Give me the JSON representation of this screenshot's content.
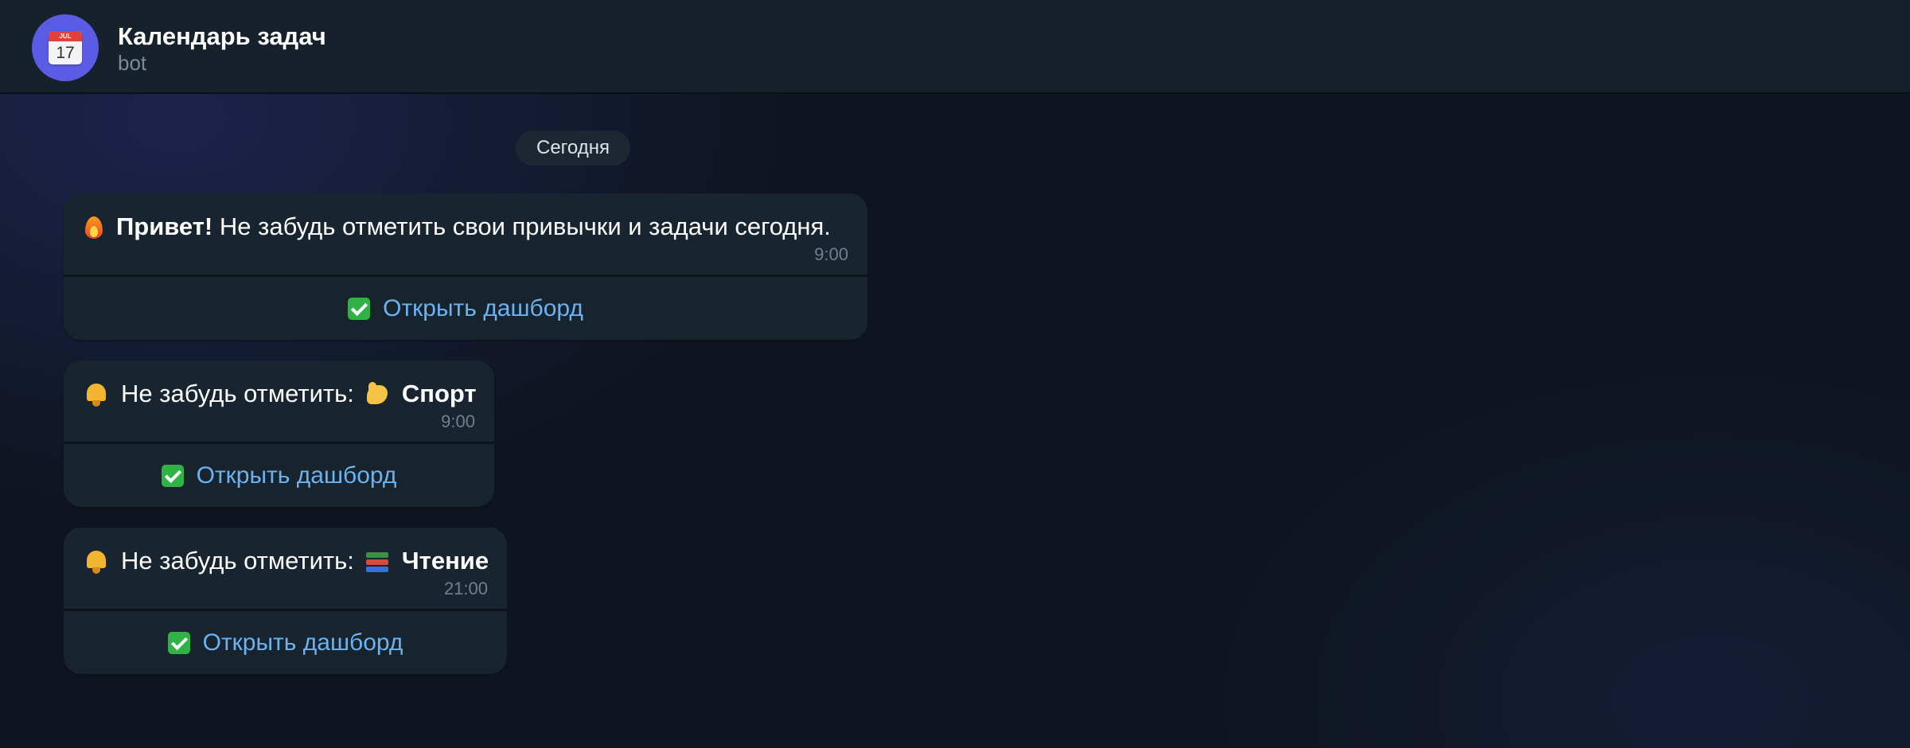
{
  "header": {
    "title": "Календарь задач",
    "subtitle": "bot",
    "avatar_icon": "calendar-icon",
    "avatar_icon_month": "JUL",
    "avatar_icon_day": "17",
    "avatar_color": "#5b5ce6"
  },
  "date_separator": "Сегодня",
  "messages": [
    {
      "icon": "fire-icon",
      "text_bold": "Привет!",
      "text": " Не забудь отметить свои привычки и задачи сегодня.",
      "time": "9:00",
      "button_label": "Открыть дашборд"
    },
    {
      "icon": "bell-icon",
      "text": "Не забудь отметить:",
      "habit_icon": "flexed-biceps-icon",
      "text_bold": "Спорт",
      "time": "9:00",
      "button_label": "Открыть дашборд"
    },
    {
      "icon": "bell-icon",
      "text": "Не забудь отметить:",
      "habit_icon": "books-icon",
      "text_bold": "Чтение",
      "time": "21:00",
      "button_label": "Открыть дашборд"
    }
  ],
  "colors": {
    "link": "#6ab3f3",
    "bubble": "#182530",
    "header": "#17212b"
  }
}
